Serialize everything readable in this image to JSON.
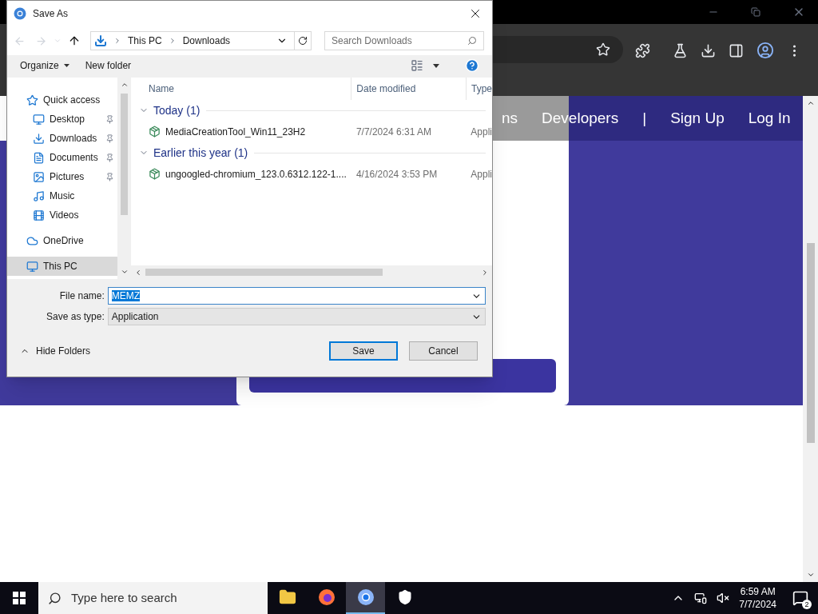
{
  "browser": {
    "nav_links": [
      "ns",
      "Developers",
      "|",
      "Sign Up",
      "Log In"
    ]
  },
  "dialog": {
    "title": "Save As",
    "address": {
      "crumbs": [
        "This PC",
        "Downloads"
      ],
      "search_placeholder": "Search Downloads"
    },
    "toolbar": {
      "organize": "Organize",
      "new_folder": "New folder"
    },
    "nav_pane": [
      {
        "label": "Quick access",
        "selected": false,
        "children": [
          {
            "label": "Desktop",
            "pinned": true,
            "selected": false
          },
          {
            "label": "Downloads",
            "pinned": true,
            "selected": false
          },
          {
            "label": "Documents",
            "pinned": true,
            "selected": false
          },
          {
            "label": "Pictures",
            "pinned": true,
            "selected": false
          },
          {
            "label": "Music",
            "pinned": false,
            "selected": false
          },
          {
            "label": "Videos",
            "pinned": false,
            "selected": false
          }
        ]
      },
      {
        "label": "OneDrive",
        "selected": false
      },
      {
        "label": "This PC",
        "selected": true
      }
    ],
    "columns": [
      "Name",
      "Date modified",
      "Type"
    ],
    "groups": [
      {
        "label": "Today (1)",
        "expanded": true,
        "files": [
          {
            "name": "MediaCreationTool_Win11_23H2",
            "date": "7/7/2024 6:31 AM",
            "type": "Appli"
          }
        ]
      },
      {
        "label": "Earlier this year (1)",
        "expanded": true,
        "files": [
          {
            "name": "ungoogled-chromium_123.0.6312.122-1....",
            "date": "4/16/2024 3:53 PM",
            "type": "Appli"
          }
        ]
      }
    ],
    "file_name": {
      "label": "File name:",
      "value": "MEMZ",
      "text_selected": true
    },
    "save_type": {
      "label": "Save as type:",
      "value": "Application"
    },
    "hide_folders": "Hide Folders",
    "buttons": [
      {
        "label": "Save",
        "default": true
      },
      {
        "label": "Cancel",
        "default": false
      }
    ]
  },
  "taskbar": {
    "search_placeholder": "Type here to search",
    "apps": [
      {
        "selected": false
      },
      {
        "selected": false
      },
      {
        "selected": true
      },
      {
        "selected": false
      }
    ],
    "time": "6:59 AM",
    "date": "7/7/2024",
    "notifications": "2"
  }
}
